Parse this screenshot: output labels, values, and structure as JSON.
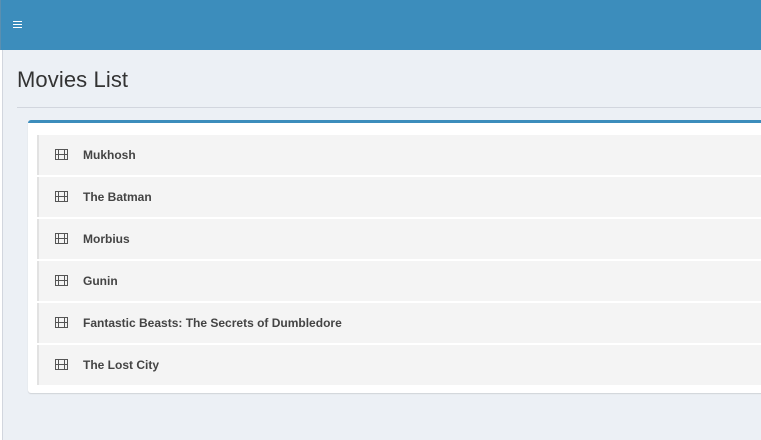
{
  "colors": {
    "header_bg": "#3c8dbc",
    "content_bg": "#ecf0f5",
    "box_border_accent": "#3c8dbc",
    "item_bg": "#f4f4f4",
    "text_primary": "#444444"
  },
  "header": {
    "menu_icon": "hamburger-menu-icon"
  },
  "page": {
    "title": "Movies List"
  },
  "movies": {
    "item_icon": "film-icon",
    "items": [
      {
        "title": "Mukhosh"
      },
      {
        "title": "The Batman"
      },
      {
        "title": "Morbius"
      },
      {
        "title": "Gunin"
      },
      {
        "title": "Fantastic Beasts: The Secrets of Dumbledore"
      },
      {
        "title": "The Lost City"
      }
    ]
  }
}
